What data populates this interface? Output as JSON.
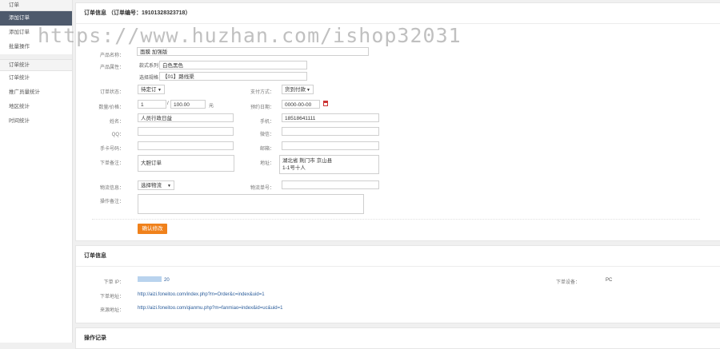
{
  "sidebar": {
    "group1": "订单",
    "items1": [
      {
        "label": "添加订单",
        "active": true
      },
      {
        "label": "添加订单"
      },
      {
        "label": "批量操作"
      }
    ],
    "group2": "订单统计",
    "items2": [
      {
        "label": "订单统计"
      },
      {
        "label": "推广员量统计"
      },
      {
        "label": "地区统计"
      },
      {
        "label": "时间统计"
      }
    ]
  },
  "order_panel": {
    "title": "订单信息 （订单编号：19101328323718）",
    "product_name_label": "产品名称：",
    "product_name_value": "面膜 加强版",
    "product_attr_label": "产品属性：",
    "attr_series_label": "款式系列：",
    "attr_series_value": "白色黑色",
    "attr_combo_label": "选择规格：",
    "attr_combo_value": "【01】路线渠",
    "order_status_label": "订单状态：",
    "order_status_value": "待定订",
    "pay_method_label": "支付方式：",
    "pay_method_value": "货到付款",
    "qty_label": "数量/价格：",
    "qty_value": "1",
    "price_value": "100.00",
    "price_unit": "元",
    "date_label": "预约日期：",
    "date_value": "0000-00-00",
    "name_label": "姓名：",
    "name_value": "人员行政日益",
    "phone_label": "手机：",
    "phone_value": "18518641111",
    "qq_label": "QQ：",
    "wechat_label": "微信：",
    "fixed_label": "手卡号码：",
    "email_label": "邮箱：",
    "address_label": "下单备注：",
    "address_value": "大胆订单",
    "addr2_label": "地址：",
    "addr2_value": "湖北省 荆门市 京山县",
    "addr2_line2": "1-1号十人",
    "logistics_label": "物流信息：",
    "logistics_value": "选择物流",
    "tracking_label": "物流单号：",
    "remark_label": "操作备注：",
    "confirm_button": "确认修改"
  },
  "order_info_panel": {
    "title": "订单信息",
    "ip_label": "下单 IP：",
    "ip_value": "20",
    "device_label": "下单设备：",
    "device_value": "PC",
    "order_url_label": "下单地址：",
    "order_url_value": "http://aizi.foneitoo.com/index.php?m=Order&c=index&uid=1",
    "source_url_label": "来源地址：",
    "source_url_value": "http://aizi.foneitoo.com/qianmu.php?m=fanmiao=index&id=uc&uid=1"
  },
  "oplog_panel": {
    "title": "操作记录"
  },
  "watermark": "https://www.huzhan.com/ishop32031"
}
